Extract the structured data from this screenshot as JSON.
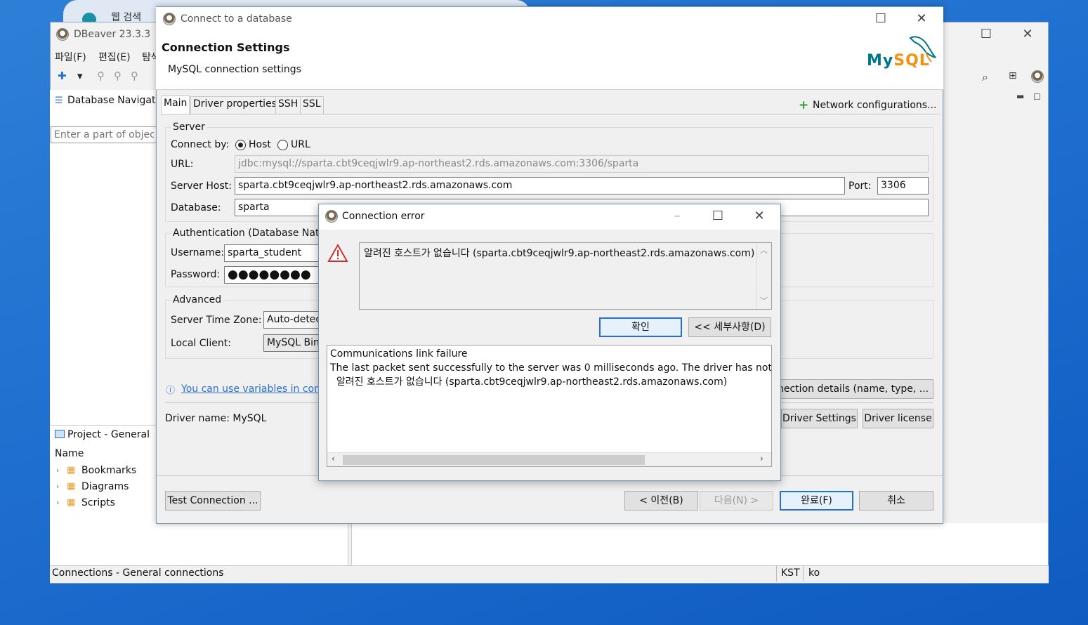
{
  "background": {
    "browser_tab_text": "웹 검색"
  },
  "main_window": {
    "title": "DBeaver 23.3.3",
    "menu": [
      "파일(F)",
      "편집(E)",
      "탐색"
    ],
    "nav_title": "Database Navigator",
    "nav_filter_placeholder": "Enter a part of object",
    "project_title": "Project - General",
    "project_col": "Name",
    "project_items": [
      "Bookmarks",
      "Diagrams",
      "Scripts"
    ],
    "status_left": "Connections - General connections",
    "status_tz": "KST",
    "status_locale": "ko"
  },
  "connect_dialog": {
    "title": "Connect to a database",
    "heading": "Connection Settings",
    "subheading": "MySQL connection settings",
    "logo_text": "MySQL",
    "tabs": [
      "Main",
      "Driver properties",
      "SSH",
      "SSL"
    ],
    "network_config": "Network configurations...",
    "server_group": "Server",
    "connect_by_label": "Connect by:",
    "connect_by_host": "Host",
    "connect_by_url": "URL",
    "url_label": "URL:",
    "url_value": "jdbc:mysql://sparta.cbt9ceqjwlr9.ap-northeast2.rds.amazonaws.com:3306/sparta",
    "host_label": "Server Host:",
    "host_value": "sparta.cbt9ceqjwlr9.ap-northeast2.rds.amazonaws.com",
    "port_label": "Port:",
    "port_value": "3306",
    "db_label": "Database:",
    "db_value": "sparta",
    "auth_group": "Authentication (Database Nati",
    "username_label": "Username:",
    "username_value": "sparta_student",
    "password_label": "Password:",
    "password_value": "●●●●●●●●",
    "advanced_group": "Advanced",
    "timezone_label": "Server Time Zone:",
    "timezone_value": "Auto-detec",
    "local_client_label": "Local Client:",
    "local_client_value": "MySQL Bin",
    "variables_link": "You can use variables in con",
    "conn_details_btn": "nection details (name, type, ... )",
    "driver_name": "Driver name:  MySQL",
    "driver_settings_btn": "Driver Settings",
    "driver_license_btn": "Driver license",
    "test_btn": "Test Connection ...",
    "prev_btn": "< 이전(B)",
    "next_btn": "다음(N) >",
    "finish_btn": "완료(F)",
    "cancel_btn": "취소"
  },
  "error_dialog": {
    "title": "Connection error",
    "message": "알려진 호스트가 없습니다 (sparta.cbt9ceqjwlr9.ap-northeast2.rds.amazonaws.com)",
    "ok_btn": "확인",
    "details_btn": "<< 세부사항(D)",
    "details_lines": [
      "Communications link failure",
      "The last packet sent successfully to the server was 0 milliseconds ago. The driver has not rec",
      "  알려진 호스트가 없습니다 (sparta.cbt9ceqjwlr9.ap-northeast2.rds.amazonaws.com)"
    ]
  },
  "colors": {
    "desktop": "#1f6fd0",
    "mysql_blue": "#00758f",
    "mysql_orange": "#f29111",
    "accent": "#2a6fd0",
    "warning": "#d03030"
  }
}
